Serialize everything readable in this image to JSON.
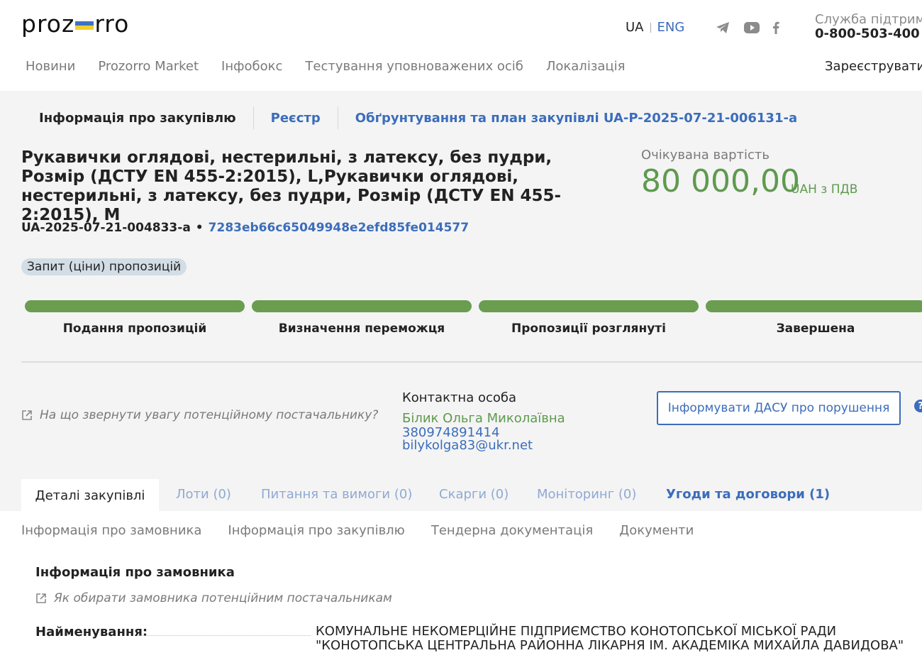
{
  "header": {
    "logo_left": "proz",
    "logo_right": "rro",
    "lang_ua": "UA",
    "lang_eng": "ENG",
    "support_label": "Служба підтримки",
    "support_phone": "0-800-503-400",
    "nav": [
      "Новини",
      "Prozorro Market",
      "Інфобокс",
      "Тестування уповноважених осіб",
      "Локалізація"
    ],
    "register": "Зареєструватися"
  },
  "subnav": {
    "info": "Інформація про закупівлю",
    "registry": "Реєстр",
    "plan_link": "Обґрунтування та план закупівлі UA-P-2025-07-21-006131-a"
  },
  "tender": {
    "title": "Рукавички оглядові, нестерильні, з латексу, без пудри, Розмір (ДСТУ EN 455-2:2015), L,Рукавички оглядові, нестерильні, з латексу, без пудри, Розмір (ДСТУ EN 455-2:2015), M",
    "id": "UA-2025-07-21-004833-a",
    "hash": "7283eb66c65049948e2efd85fe014577",
    "type_badge": "Запит (ціни) пропозицій",
    "expected_label": "Очікувана вартість",
    "expected_amount": "80 000,00",
    "expected_unit": "UAH з ПДВ"
  },
  "stages": [
    {
      "label": "Подання пропозицій",
      "progress": 1
    },
    {
      "label": "Визначення переможця",
      "progress": 1
    },
    {
      "label": "Пропозиції розглянуті",
      "progress": 1
    },
    {
      "label": "Завершена",
      "progress": 1
    }
  ],
  "contact": {
    "hint": "На що звернути увагу потенційному постачальнику?",
    "label": "Контактна особа",
    "name": "Білик Ольга Миколаївна",
    "phone": "380974891414",
    "email": "bilykolga83@ukr.net",
    "dasu_button": "Інформувати ДАСУ про порушення",
    "help": "?"
  },
  "tabs": {
    "details": "Деталі закупівлі",
    "lots": "Лоти (0)",
    "questions": "Питання та вимоги (0)",
    "complaints": "Скарги (0)",
    "monitoring": "Моніторинг (0)",
    "contracts": "Угоди та договори (1)"
  },
  "sections": [
    "Інформація про замовника",
    "Інформація про закупівлю",
    "Тендерна документація",
    "Документи"
  ],
  "customer": {
    "title": "Інформація про замовника",
    "hint": "Як обирати замовника потенційним постачальникам",
    "name_label": "Найменування:",
    "name_value": "КОМУНАЛЬНЕ НЕКОМЕРЦІЙНЕ ПІДПРИЄМСТВО КОНОТОПСЬКОЇ МІСЬКОЇ РАДИ \"КОНОТОПСЬКА ЦЕНТРАЛЬНА РАЙОННА ЛІКАРНЯ ІМ. АКАДЕМІКА МИХАЙЛА ДАВИДОВА\""
  },
  "colors": {
    "accent_blue": "#3b6dbb",
    "green": "#5e9a4e",
    "stage_green": "#6a9d4f",
    "gray_bg": "#f4f4f4"
  },
  "icons": [
    "telegram-icon",
    "youtube-icon",
    "facebook-icon",
    "external-link-icon",
    "help-icon"
  ]
}
